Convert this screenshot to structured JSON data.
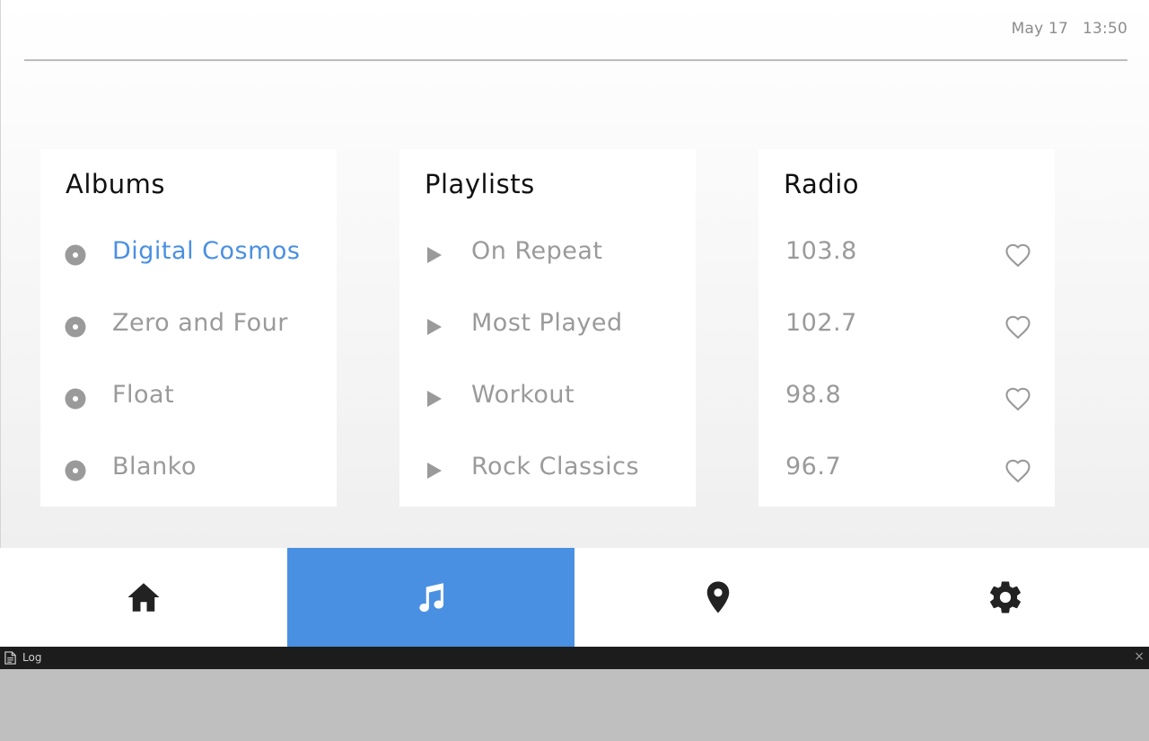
{
  "status": {
    "date": "May 17",
    "time": "13:50"
  },
  "albums": {
    "title": "Albums",
    "items": [
      {
        "label": "Digital Cosmos",
        "active": true
      },
      {
        "label": "Zero and Four"
      },
      {
        "label": "Float"
      },
      {
        "label": "Blanko"
      }
    ]
  },
  "playlists": {
    "title": "Playlists",
    "items": [
      {
        "label": "On Repeat"
      },
      {
        "label": "Most Played"
      },
      {
        "label": "Workout"
      },
      {
        "label": "Rock Classics"
      }
    ]
  },
  "radio": {
    "title": "Radio",
    "items": [
      {
        "label": "103.8"
      },
      {
        "label": "102.7"
      },
      {
        "label": "98.8"
      },
      {
        "label": "96.7"
      }
    ]
  },
  "nav": {
    "tabs": [
      {
        "icon": "home-icon"
      },
      {
        "icon": "music-note-icon",
        "active": true
      },
      {
        "icon": "map-pin-icon"
      },
      {
        "icon": "gear-icon"
      }
    ]
  },
  "log": {
    "title": "Log",
    "close": "×"
  },
  "colors": {
    "accent": "#4a90e2",
    "muted": "#9a9a9a",
    "icon": "#222222"
  }
}
